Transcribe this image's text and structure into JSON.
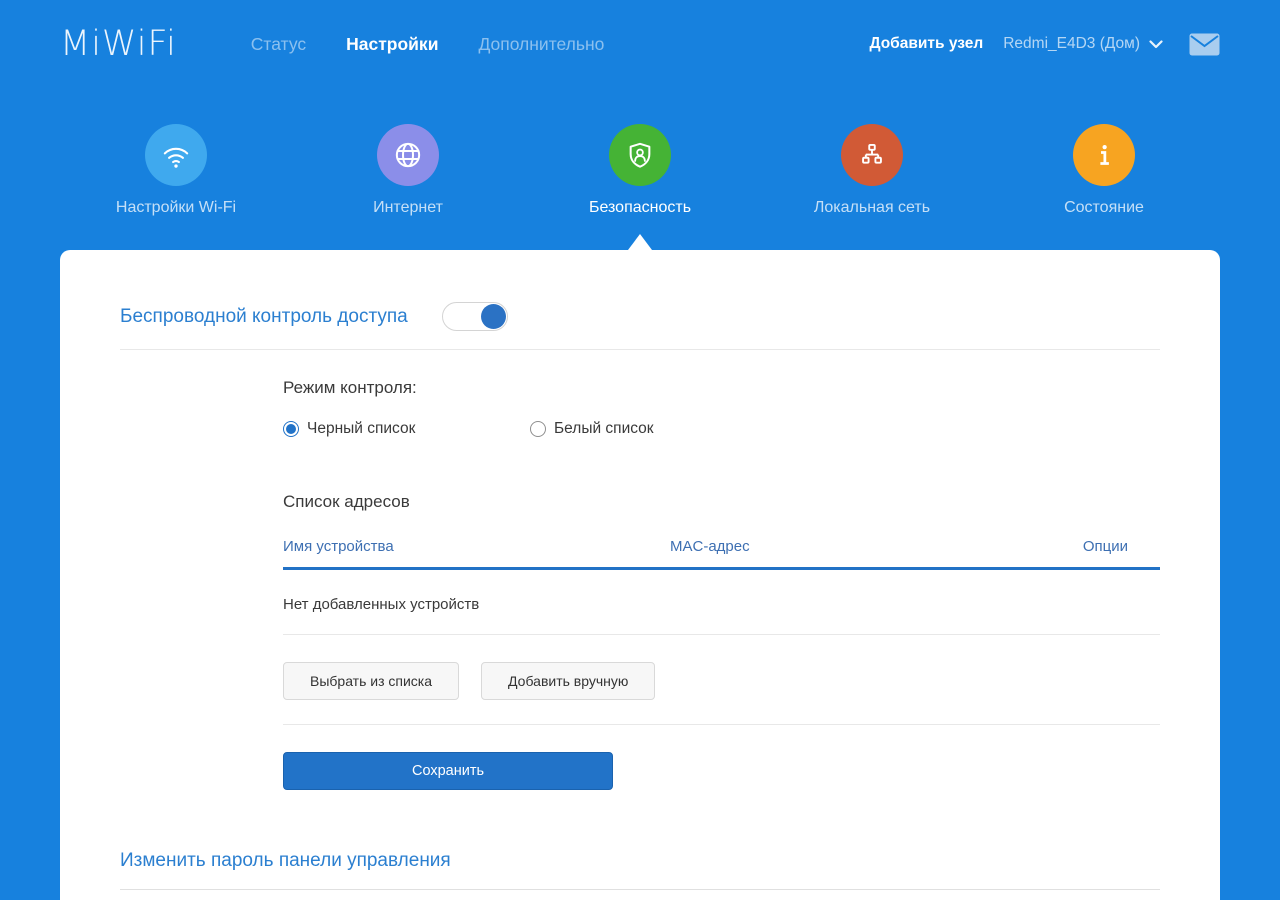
{
  "app": {
    "logo_text": "MiWiFi"
  },
  "header": {
    "nav": [
      {
        "label": "Статус",
        "active": false
      },
      {
        "label": "Настройки",
        "active": true
      },
      {
        "label": "Дополнительно",
        "active": false
      }
    ],
    "add_node_label": "Добавить узел",
    "device_selector_label": "Redmi_E4D3 (Дом)"
  },
  "tabs": [
    {
      "label": "Настройки Wi-Fi",
      "color": "#3fa9ee",
      "active": false
    },
    {
      "label": "Интернет",
      "color": "#8b8ee9",
      "active": false
    },
    {
      "label": "Безопасность",
      "color": "#45b335",
      "active": true
    },
    {
      "label": "Локальная сеть",
      "color": "#d15a36",
      "active": false
    },
    {
      "label": "Состояние",
      "color": "#f7a421",
      "active": false
    }
  ],
  "security": {
    "access_control_title": "Беспроводной контроль доступа",
    "toggle_on": true,
    "mode_label": "Режим контроля:",
    "mode_options": [
      {
        "label": "Черный список",
        "selected": true
      },
      {
        "label": "Белый список",
        "selected": false
      }
    ],
    "address_list_title": "Список адресов",
    "table": {
      "columns": [
        "Имя устройства",
        "MAC-адрес",
        "Опции"
      ],
      "empty_text": "Нет добавленных устройств"
    },
    "select_from_list_label": "Выбрать из списка",
    "add_manually_label": "Добавить вручную",
    "save_label": "Сохранить"
  },
  "change_password_title": "Изменить пароль панели управления",
  "colors": {
    "background_blue": "#1781de",
    "accent_blue": "#2273c8",
    "heading_blue": "#2b7fd0",
    "table_header_blue": "#3d6fb2"
  }
}
